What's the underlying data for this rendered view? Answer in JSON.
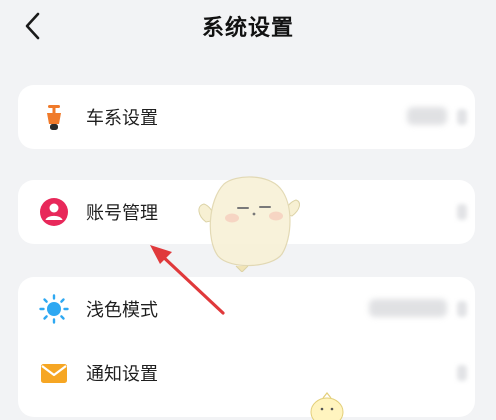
{
  "header": {
    "title": "系统设置"
  },
  "settings": {
    "vehicle": {
      "label": "车系设置"
    },
    "account": {
      "label": "账号管理"
    },
    "theme": {
      "label": "浅色模式"
    },
    "notifications": {
      "label": "通知设置"
    }
  },
  "colors": {
    "background": "#f2f3f5",
    "card": "#ffffff",
    "scooter_orange": "#f07a2a",
    "account_red": "#e8285a",
    "theme_blue": "#2ea8f2",
    "mail_orange": "#f6a623",
    "arrow_red": "#e0393b"
  },
  "icons": {
    "back": "chevron-left-icon",
    "vehicle": "scooter-icon",
    "account": "user-circle-icon",
    "theme": "sun-icon",
    "notifications": "envelope-icon"
  }
}
